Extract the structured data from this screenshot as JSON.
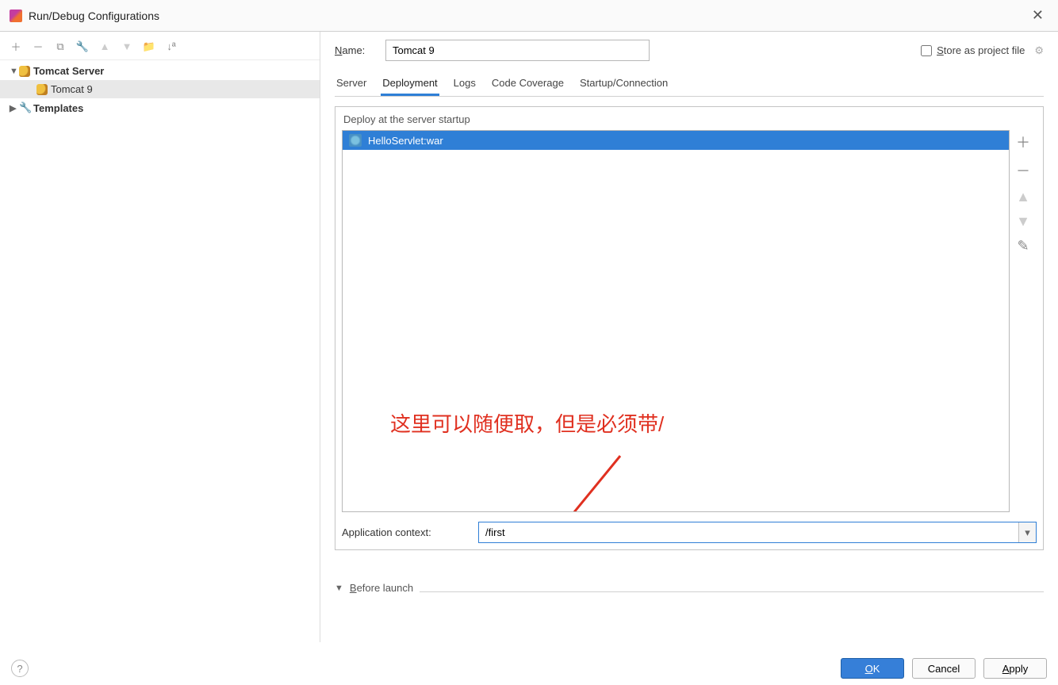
{
  "dialog": {
    "title": "Run/Debug Configurations"
  },
  "tree": {
    "root": {
      "label": "Tomcat Server"
    },
    "child": {
      "label": "Tomcat 9"
    },
    "templates": {
      "label": "Templates"
    }
  },
  "name": {
    "label": "Name:",
    "value": "Tomcat 9"
  },
  "store": {
    "label": "Store as project file"
  },
  "tabs": {
    "server": "Server",
    "deployment": "Deployment",
    "logs": "Logs",
    "codeCoverage": "Code Coverage",
    "startup": "Startup/Connection"
  },
  "deploy": {
    "sectionTitle": "Deploy at the server startup",
    "items": [
      "HelloServlet:war"
    ]
  },
  "annotation": "这里可以随便取，但是必须带/",
  "appContext": {
    "label": "Application context:",
    "value": "/first"
  },
  "beforeLaunch": {
    "label": "Before launch"
  },
  "buttons": {
    "ok": "OK",
    "cancel": "Cancel",
    "apply": "Apply"
  }
}
